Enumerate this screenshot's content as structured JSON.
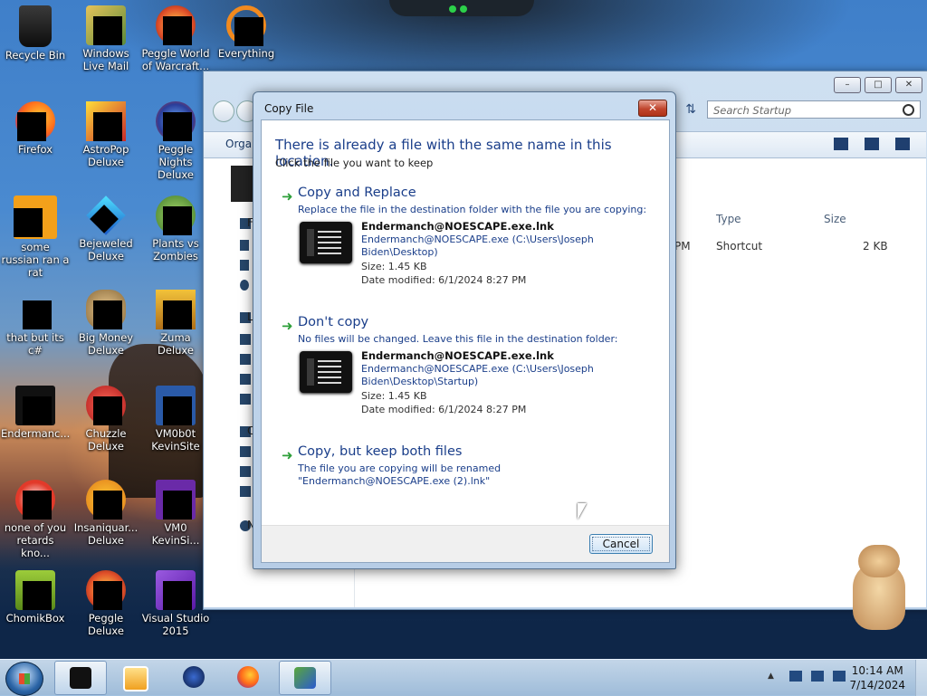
{
  "desktop": {
    "icons": [
      {
        "label": "Recycle Bin",
        "icon": "recycle-bin-icon"
      },
      {
        "label": "Windows Live Mail",
        "icon": "windows-live-mail-icon"
      },
      {
        "label": "Peggle World of Warcraft...",
        "icon": "peggle-wow-icon"
      },
      {
        "label": "Everything",
        "icon": "everything-search-icon"
      },
      {
        "label": "Firefox",
        "icon": "firefox-icon"
      },
      {
        "label": "AstroPop Deluxe",
        "icon": "astropop-icon"
      },
      {
        "label": "Peggle Nights Deluxe",
        "icon": "peggle-nights-icon"
      },
      {
        "label": "some russian ran a rat",
        "icon": "folder-icon"
      },
      {
        "label": "Bejeweled Deluxe",
        "icon": "bejeweled-icon"
      },
      {
        "label": "Plants vs Zombies",
        "icon": "plants-vs-zombies-icon"
      },
      {
        "label": "that but its c#",
        "icon": "shortcut-icon"
      },
      {
        "label": "Big Money Deluxe",
        "icon": "big-money-icon"
      },
      {
        "label": "Zuma Deluxe",
        "icon": "zuma-icon"
      },
      {
        "label": "Endermanc...",
        "icon": "enderman-shortcut-icon"
      },
      {
        "label": "Chuzzle Deluxe",
        "icon": "chuzzle-icon"
      },
      {
        "label": "VM0b0t KevinSite",
        "icon": "vm-folder-icon"
      },
      {
        "label": "none of you retards kno...",
        "icon": "firefox-like-icon"
      },
      {
        "label": "Insaniquar... Deluxe",
        "icon": "insaniquarium-icon"
      },
      {
        "label": "VM0 KevinSi...",
        "icon": "vm-icon"
      },
      {
        "label": "ChomikBox",
        "icon": "chomikbox-icon"
      },
      {
        "label": "Peggle Deluxe",
        "icon": "peggle-icon"
      },
      {
        "label": "Visual Studio 2015",
        "icon": "visual-studio-icon"
      }
    ]
  },
  "explorer": {
    "search_placeholder": "Search Startup",
    "toolbar_organize": "Organ",
    "col_type": "Type",
    "col_size": "Size",
    "row_time_fragment": "PM",
    "row_type": "Shortcut",
    "row_size": "2 KB",
    "nav_letters": [
      "F",
      "L",
      "C",
      "N"
    ]
  },
  "dialog": {
    "title": "Copy File",
    "close_label": "x",
    "heading": "There is already a file with the same name in this location.",
    "subheading": "Click the file you want to keep",
    "option_replace": {
      "title": "Copy and Replace",
      "desc": "Replace the file in the destination folder with the file you are copying:",
      "file_name": "Endermanch@NOESCAPE.exe.lnk",
      "file_path": "Endermanch@NOESCAPE.exe (C:\\Users\\Joseph Biden\\Desktop)",
      "size": "Size: 1.45 KB",
      "date": "Date modified: 6/1/2024 8:27 PM"
    },
    "option_skip": {
      "title": "Don't copy",
      "desc": "No files will be changed. Leave this file in the destination folder:",
      "file_name": "Endermanch@NOESCAPE.exe.lnk",
      "file_path": "Endermanch@NOESCAPE.exe (C:\\Users\\Joseph Biden\\Desktop\\Startup)",
      "size": "Size: 1.45 KB",
      "date": "Date modified: 6/1/2024 8:27 PM"
    },
    "option_both": {
      "title": "Copy, but keep both files",
      "desc": "The file you are copying will be renamed \"Endermanch@NOESCAPE.exe (2).lnk\""
    },
    "cancel_label": "Cancel"
  },
  "taskbar": {
    "time": "10:14 AM",
    "date": "7/14/2024",
    "buttons": [
      "start-orb-icon",
      "explorer-icon",
      "media-player-icon",
      "app-icon",
      "firefox-icon",
      "users-icon"
    ]
  },
  "colors": {
    "link_blue": "#1a3e8a",
    "arrow_green": "#2e9f3a",
    "close_red": "#c0452d"
  }
}
